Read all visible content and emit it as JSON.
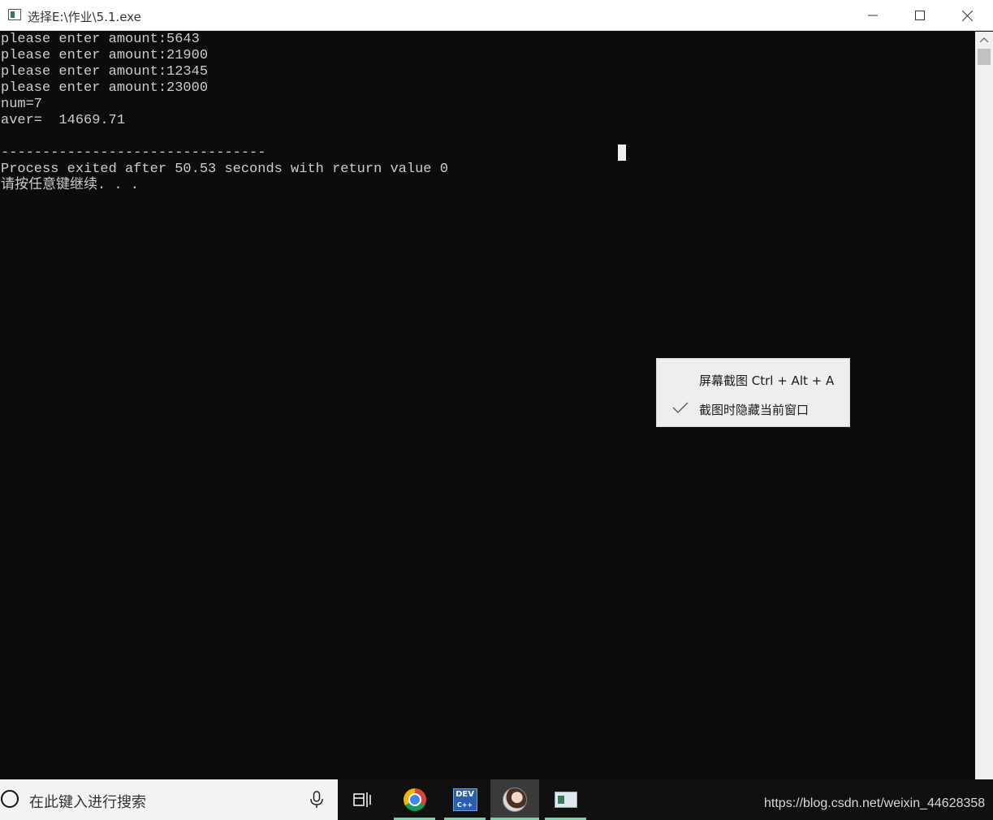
{
  "window": {
    "title": "选择E:\\作业\\5.1.exe",
    "controls": {
      "minimize_icon": "minimize-icon",
      "maximize_icon": "maximize-icon",
      "close_icon": "close-icon"
    }
  },
  "console": {
    "lines": [
      "please enter amount:5643",
      "please enter amount:21900",
      "please enter amount:12345",
      "please enter amount:23000",
      "num=7",
      "aver=  14669.71",
      "",
      "--------------------------------",
      "Process exited after 50.53 seconds with return value 0",
      "请按任意键继续. . ."
    ],
    "text_color": "#cccccc",
    "background_color": "#0c0c0c"
  },
  "context_menu": {
    "items": [
      {
        "label": "屏幕截图 Ctrl + Alt + A",
        "checked": false
      },
      {
        "label": "截图时隐藏当前窗口",
        "checked": true
      }
    ]
  },
  "taskbar": {
    "search_placeholder": "在此键入进行搜索",
    "apps": [
      "task-view-icon",
      "chrome-icon",
      "dev-cpp-icon",
      "avatar-icon",
      "console-app-icon"
    ],
    "dev_icon_text": "DEV",
    "dev_icon_subtext": "C++",
    "active_indicator_color": "#7ad0a8",
    "watermark": "https://blog.csdn.net/weixin_44628358"
  }
}
